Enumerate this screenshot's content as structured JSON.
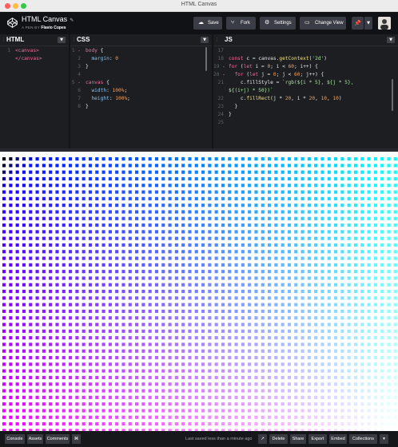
{
  "window": {
    "title": "HTML Canvas"
  },
  "header": {
    "pen_title": "HTML Canvas",
    "byline_prefix": "A PEN BY",
    "author": "Flavio Copes",
    "buttons": {
      "save": "Save",
      "fork": "Fork",
      "settings": "Settings",
      "change_view": "Change View"
    }
  },
  "panels": {
    "html": {
      "name": "HTML",
      "lines": [
        {
          "n": "1",
          "parts": [
            {
              "t": "<canvas>",
              "c": "pink"
            }
          ]
        },
        {
          "n": "",
          "parts": [
            {
              "t": "</canvas>",
              "c": "pink"
            }
          ]
        }
      ]
    },
    "css": {
      "name": "CSS",
      "lines": [
        {
          "n": "1",
          "m": "-",
          "parts": [
            {
              "t": "body",
              "c": "pink"
            },
            {
              "t": " {",
              "c": "wht"
            }
          ]
        },
        {
          "n": "2",
          "parts": [
            {
              "t": "  margin",
              "c": "blu"
            },
            {
              "t": ": ",
              "c": "wht"
            },
            {
              "t": "0",
              "c": "org"
            }
          ]
        },
        {
          "n": "3",
          "parts": [
            {
              "t": "}",
              "c": "wht"
            }
          ]
        },
        {
          "n": "4",
          "parts": []
        },
        {
          "n": "5",
          "m": "-",
          "parts": [
            {
              "t": "canvas",
              "c": "pink"
            },
            {
              "t": " {",
              "c": "wht"
            }
          ]
        },
        {
          "n": "6",
          "parts": [
            {
              "t": "  width",
              "c": "blu"
            },
            {
              "t": ": ",
              "c": "wht"
            },
            {
              "t": "100%",
              "c": "org"
            },
            {
              "t": ";",
              "c": "wht"
            }
          ]
        },
        {
          "n": "7",
          "parts": [
            {
              "t": "  height",
              "c": "blu"
            },
            {
              "t": ": ",
              "c": "wht"
            },
            {
              "t": "100%",
              "c": "org"
            },
            {
              "t": ";",
              "c": "wht"
            }
          ]
        },
        {
          "n": "8",
          "parts": [
            {
              "t": "}",
              "c": "wht"
            }
          ]
        }
      ]
    },
    "js": {
      "name": "JS",
      "lines": [
        {
          "n": "17",
          "parts": []
        },
        {
          "n": "18",
          "parts": [
            {
              "t": "const",
              "c": "pink"
            },
            {
              "t": " c = canvas.",
              "c": "wht"
            },
            {
              "t": "getContext",
              "c": "yel"
            },
            {
              "t": "(",
              "c": "wht"
            },
            {
              "t": "'2d'",
              "c": "grn"
            },
            {
              "t": ")",
              "c": "wht"
            }
          ]
        },
        {
          "n": "19",
          "m": "-",
          "parts": [
            {
              "t": "for",
              "c": "pink"
            },
            {
              "t": " (",
              "c": "wht"
            },
            {
              "t": "let",
              "c": "pink"
            },
            {
              "t": " i = ",
              "c": "wht"
            },
            {
              "t": "0",
              "c": "org"
            },
            {
              "t": "; i < ",
              "c": "wht"
            },
            {
              "t": "60",
              "c": "org"
            },
            {
              "t": "; i++) {",
              "c": "wht"
            }
          ]
        },
        {
          "n": "20",
          "m": "-",
          "parts": [
            {
              "t": "  for",
              "c": "pink"
            },
            {
              "t": " (",
              "c": "wht"
            },
            {
              "t": "let",
              "c": "pink"
            },
            {
              "t": " j = ",
              "c": "wht"
            },
            {
              "t": "0",
              "c": "org"
            },
            {
              "t": "; j < ",
              "c": "wht"
            },
            {
              "t": "60",
              "c": "org"
            },
            {
              "t": "; j++) {",
              "c": "wht"
            }
          ]
        },
        {
          "n": "21",
          "parts": [
            {
              "t": "    c.fillStyle = ",
              "c": "wht"
            },
            {
              "t": "`rgb(${i * 5}, ${j * 5},",
              "c": "grn"
            }
          ]
        },
        {
          "n": "",
          "parts": [
            {
              "t": "${(i+j) * 50})`",
              "c": "grn"
            }
          ]
        },
        {
          "n": "22",
          "parts": [
            {
              "t": "    c.",
              "c": "wht"
            },
            {
              "t": "fillRect",
              "c": "yel"
            },
            {
              "t": "(j * ",
              "c": "wht"
            },
            {
              "t": "20",
              "c": "org"
            },
            {
              "t": ", i * ",
              "c": "wht"
            },
            {
              "t": "20",
              "c": "org"
            },
            {
              "t": ", ",
              "c": "wht"
            },
            {
              "t": "10",
              "c": "org"
            },
            {
              "t": ", ",
              "c": "wht"
            },
            {
              "t": "10",
              "c": "org"
            },
            {
              "t": ")",
              "c": "wht"
            }
          ]
        },
        {
          "n": "23",
          "parts": [
            {
              "t": "  }",
              "c": "wht"
            }
          ]
        },
        {
          "n": "24",
          "parts": [
            {
              "t": "}",
              "c": "wht"
            }
          ]
        },
        {
          "n": "25",
          "parts": []
        }
      ]
    }
  },
  "footer": {
    "console": "Console",
    "assets": "Assets",
    "comments": "Comments",
    "saved_status": "Last saved less than a minute ago",
    "delete": "Delete",
    "share": "Share",
    "export": "Export",
    "embed": "Embed",
    "collections": "Collections"
  },
  "colors": {
    "header_bg": "#111216",
    "editor_bg": "#1d1e22",
    "footer_bg": "#16171b",
    "button_bg": "#3a3d45"
  },
  "icons": {
    "logo": "codepen-logo-icon",
    "save": "cloud-icon",
    "fork": "fork-icon",
    "settings": "gear-icon",
    "change_view": "layout-icon",
    "pin": "pin-icon"
  }
}
